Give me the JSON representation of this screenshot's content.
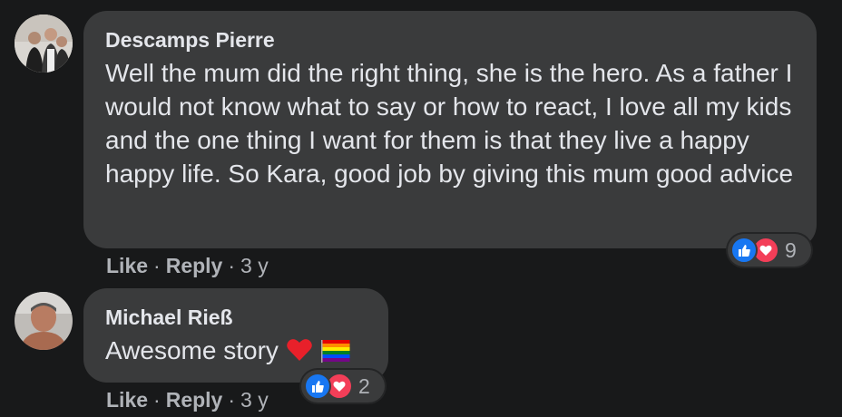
{
  "comments": [
    {
      "author": "Descamps Pierre",
      "text": "Well the mum did the right thing, she is the hero. As a father I would not know what to say or how to react, I love all my kids and the one thing I want for them is that they live a happy happy life. So Kara, good job by giving this mum good advice",
      "reaction_count": "9",
      "like_label": "Like",
      "reply_label": "Reply",
      "time": "3 y"
    },
    {
      "author": "Michael Rieß",
      "text": "Awesome story",
      "emojis": [
        "red-heart-emoji",
        "rainbow-flag-emoji"
      ],
      "reaction_count": "2",
      "like_label": "Like",
      "reply_label": "Reply",
      "time": "3 y"
    }
  ],
  "colors": {
    "background": "#18191a",
    "bubble": "#3a3b3c",
    "text": "#e4e6eb",
    "secondary_text": "#b0b3b8",
    "like_blue": "#1877f2",
    "love_red": "#f33e58"
  }
}
